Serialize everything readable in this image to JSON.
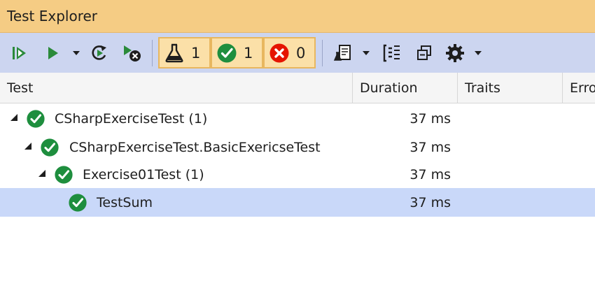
{
  "window": {
    "title": "Test Explorer"
  },
  "toolbar": {
    "buttons": [
      {
        "name": "run-all-tests-icon"
      },
      {
        "name": "run-icon"
      },
      {
        "name": "run-dropdown-arrow-icon"
      },
      {
        "name": "repeat-last-run-icon"
      },
      {
        "name": "cancel-run-icon"
      }
    ],
    "filters": [
      {
        "icon": "flask-icon",
        "count": "1"
      },
      {
        "icon": "passed-icon",
        "count": "1"
      },
      {
        "icon": "failed-icon",
        "count": "0"
      }
    ],
    "right_buttons": [
      {
        "name": "playlist-icon"
      },
      {
        "name": "playlist-dropdown-arrow-icon"
      },
      {
        "name": "group-by-icon"
      },
      {
        "name": "collapse-all-icon"
      },
      {
        "name": "settings-gear-icon"
      },
      {
        "name": "settings-dropdown-arrow-icon"
      }
    ]
  },
  "columns": [
    "Test",
    "Duration",
    "Traits",
    "Erro"
  ],
  "tree": [
    {
      "label": "CSharpExerciseTest  (1)",
      "duration": "37 ms",
      "status": "passed",
      "expanded": true,
      "level": 0
    },
    {
      "label": "CSharpExerciseTest.BasicExericseTest",
      "duration": "37 ms",
      "status": "passed",
      "expanded": true,
      "level": 1
    },
    {
      "label": "Exercise01Test  (1)",
      "duration": "37 ms",
      "status": "passed",
      "expanded": true,
      "level": 2
    },
    {
      "label": "TestSum",
      "duration": "37 ms",
      "status": "passed",
      "expanded": false,
      "level": 3,
      "selected": true
    }
  ],
  "colors": {
    "titlebar": "#f5cc84",
    "toolbar": "#ccd5f0",
    "passed": "#1e8e3e",
    "failed": "#e51400",
    "selection": "#c9d8f9",
    "run_green": "#2a8a3a"
  }
}
